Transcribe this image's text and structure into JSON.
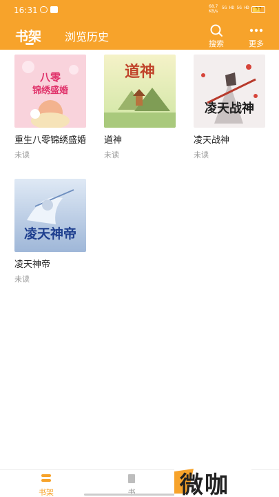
{
  "status_bar": {
    "time": "16:31",
    "network_speed": "68.7",
    "network_unit": "KB/s",
    "signal_labels": "5G HD 5G HD",
    "battery": "57",
    "icons": [
      "chat-bubble-icon",
      "app-notification-icon"
    ]
  },
  "header": {
    "tabs": [
      {
        "label": "书架",
        "active": true
      },
      {
        "label": "浏览历史",
        "active": false
      }
    ],
    "actions": [
      {
        "label": "搜索",
        "icon": "search-icon"
      },
      {
        "label": "更多",
        "icon": "more-dots-icon"
      }
    ]
  },
  "books": [
    {
      "title": "重生八零锦绣盛婚",
      "status": "未读",
      "cover_text": "重生八零锦绣盛婚"
    },
    {
      "title": "道神",
      "status": "未读",
      "cover_text": "道神"
    },
    {
      "title": "凌天战神",
      "status": "未读",
      "cover_text": "凌天战神"
    },
    {
      "title": "凌天神帝",
      "status": "未读",
      "cover_text": "凌天神帝"
    }
  ],
  "bottom_nav": [
    {
      "label": "书架",
      "icon": "bookshelf-icon",
      "active": true
    },
    {
      "label": "书",
      "icon": "bookstore-icon",
      "active": false
    }
  ],
  "watermark": "微咖",
  "colors": {
    "accent": "#f7a32b",
    "text": "#222222",
    "muted": "#9a9a9a"
  }
}
